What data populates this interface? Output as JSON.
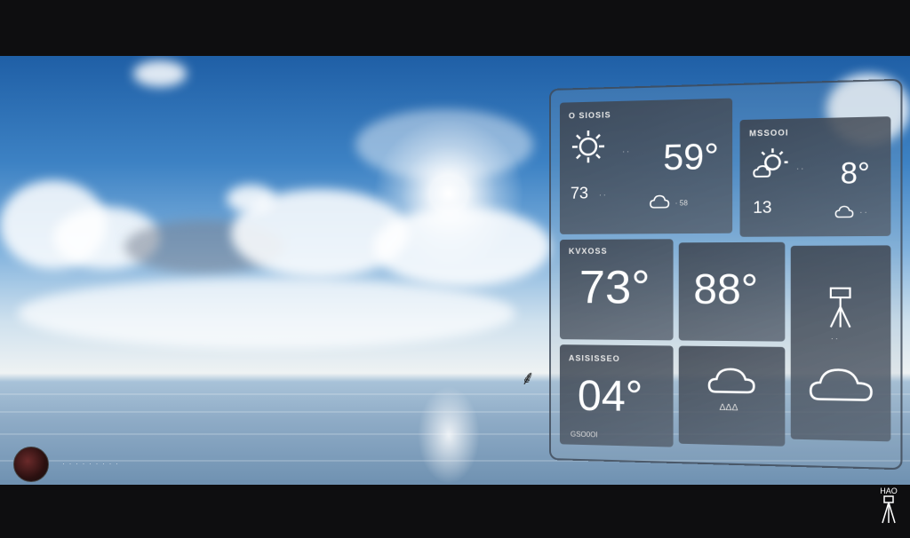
{
  "widget": {
    "tile1": {
      "label": "O SIOSIS",
      "temp": "59°",
      "small_temp": "73",
      "sub_a": "· ·",
      "sub_b": "· ·",
      "sub_c": "· 58"
    },
    "tile2": {
      "label": "MSSOOI",
      "temp": "8°",
      "small_temp": "13",
      "sub_a": "· ·",
      "sub_b": "· ·"
    },
    "tile3": {
      "label": "KVXOSS",
      "temp": "73°"
    },
    "tile4": {
      "temp": "88°"
    },
    "tile6": {
      "label": "ASISISSEO",
      "temp": "04°",
      "foot": "GSO0OI"
    },
    "tile7": {
      "sub": "ΔΔΔ"
    },
    "tile5": {
      "sub": "· ·"
    }
  },
  "watermark": {
    "text": "HAO"
  },
  "user": {
    "caption": "· · · · · · · · ·"
  }
}
